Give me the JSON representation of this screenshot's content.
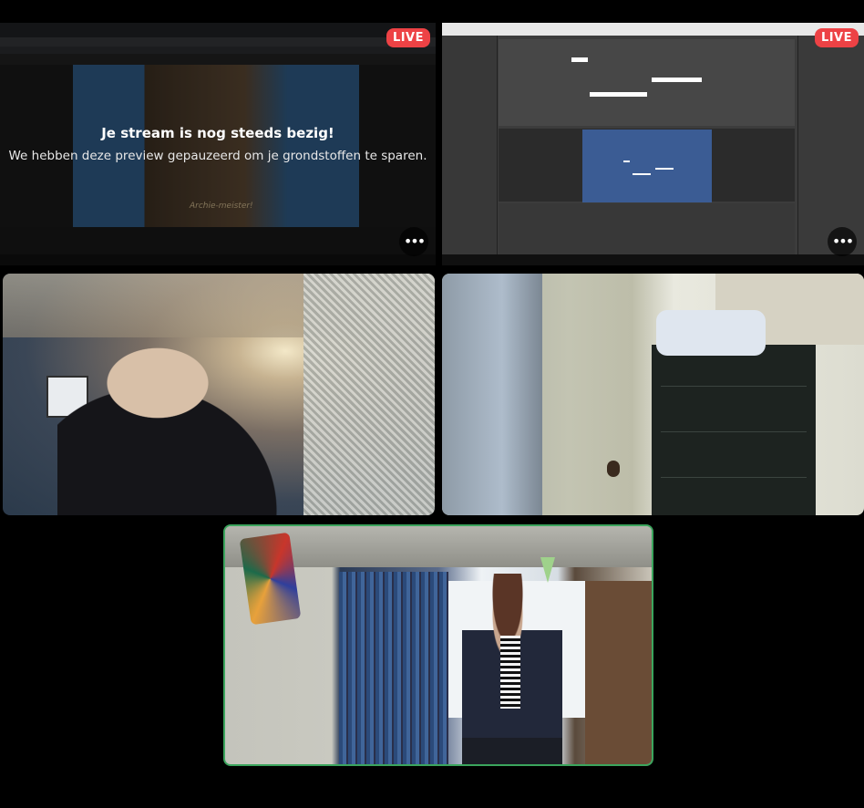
{
  "call": {
    "live_label": "LIVE",
    "more_glyph": "•••"
  },
  "tiles": [
    {
      "id": "stream-1",
      "paused_title": "Je stream is nog steeds bezig!",
      "paused_subtitle": "We hebben deze preview gepauzeerd om je grondstoffen te sparen.",
      "video_caption": "Archie-meister!"
    },
    {
      "id": "stream-2"
    },
    {
      "id": "camera-1"
    },
    {
      "id": "camera-2"
    },
    {
      "id": "camera-3",
      "speaking": true
    }
  ],
  "colors": {
    "live_red": "#ed4245",
    "speaking_green": "#3ba55d",
    "background": "#000000"
  }
}
